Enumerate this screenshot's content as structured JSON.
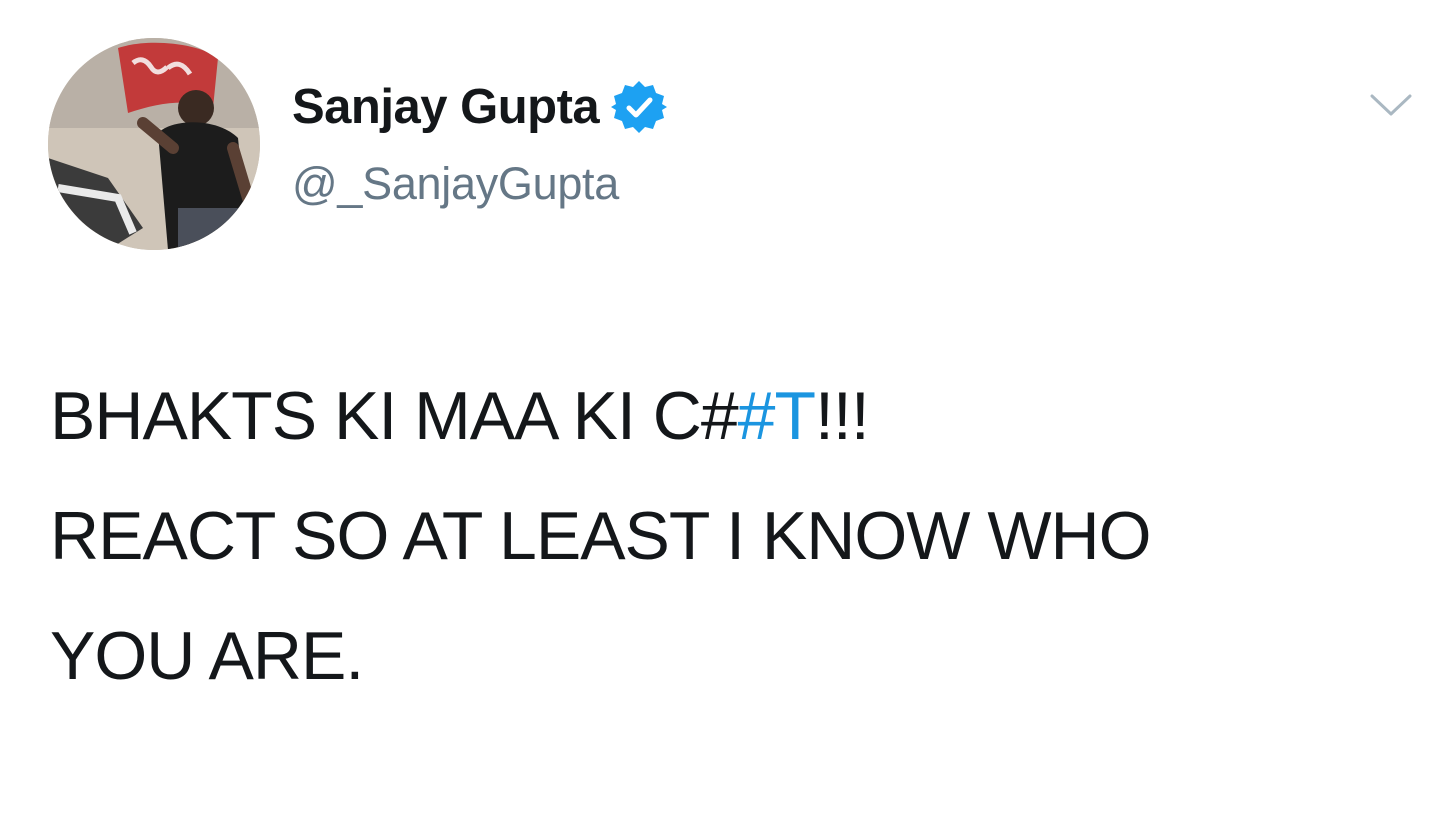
{
  "author": {
    "display_name": "Sanjay Gupta",
    "handle": "@_SanjayGupta",
    "verified": true,
    "verified_color": "#1da1f2"
  },
  "tweet": {
    "line1_pre": "BHAKTS KI MAA KI C#",
    "line1_hashtag": "#T",
    "line1_post": "!!!",
    "line2": "REACT SO AT LEAST I KNOW WHO",
    "line3": "YOU ARE.",
    "hashtag_color": "#1b95e0"
  },
  "meta": {
    "time_date": "",
    "source": ""
  },
  "icons": {
    "menu": "chevron-down-icon",
    "verified": "verified-badge-icon",
    "avatar": "profile-photo"
  }
}
